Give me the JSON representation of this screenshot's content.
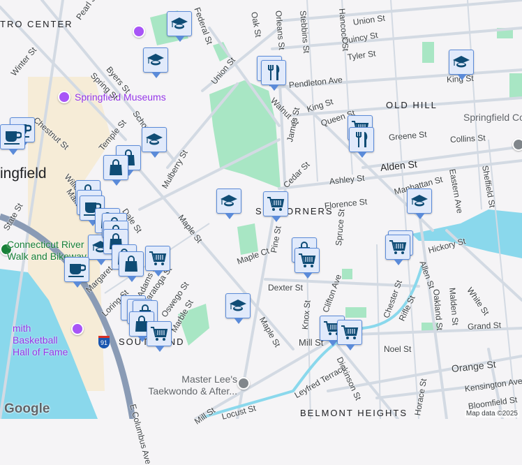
{
  "neighborhoods": [
    "TRO CENTER",
    "OLD HILL",
    "SIX CORNERS",
    "SOUTH END",
    "BELMONT HEIGHTS"
  ],
  "city": "ingfield",
  "pois": {
    "museums": "Springfield Museums",
    "riverwalk": "Connecticut River Walk and Bikeway",
    "hof": "mith Basketball Hall of Fame",
    "college": "Springfield Co",
    "taekwondo": "Master Lee's Taekwondo & After...",
    "highway_shield": "91"
  },
  "streets": [
    "Pearl St",
    "Winter St",
    "Byers St",
    "Spring St",
    "Chestnut St",
    "Temple St",
    "School St",
    "Union St",
    "Mulberry St",
    "Oak St",
    "Orleans St",
    "Stebbins St",
    "Hancock St",
    "Union St",
    "Quincy St",
    "Tyler St",
    "Pendleton Ave",
    "King St",
    "Walnut St",
    "Queen St",
    "James St",
    "Greene St",
    "Collins St",
    "King St",
    "Cedar St",
    "Alden St",
    "Ashley St",
    "Manhattan St",
    "Florence St",
    "Eastern Ave",
    "Sheffield St",
    "Maple St",
    "Main St",
    "State St",
    "Dale St",
    "Willow St",
    "Maple Ct",
    "Pine St",
    "Spruce St",
    "Hickory St",
    "Allen St",
    "Margaret St",
    "Loring St",
    "Saratoga St",
    "Oswego St",
    "Marble St",
    "Dexter St",
    "Clifton Ave",
    "Knox St",
    "Chester St",
    "Rifle St",
    "Oakland St",
    "Malden St",
    "White St",
    "Grand St",
    "Maple St",
    "Mill St",
    "Noel St",
    "Orange St",
    "Dickinson St",
    "Leyfred Terrace",
    "Kensington Ave",
    "Bloomfield St",
    "Horace St",
    "Locust St",
    "Mill St",
    "E Columbus Ave",
    "Federal St",
    "Adams St"
  ],
  "markers": {
    "school": "school-marker",
    "shopping": "shopping-bag-marker",
    "coffee": "cafe-marker",
    "restaurant": "restaurant-marker",
    "grocery": "grocery-cart-marker"
  },
  "colors": {
    "water": "#8ad8ec",
    "park": "#a8e6c4",
    "highway": "#8a9bb5",
    "road": "#d3dae3",
    "beige": "#f6ecd7",
    "marker_bg": "#e1eafb",
    "marker_icon": "#0f4c75"
  },
  "google_logo": "Google",
  "attribution": "Map data ©2025"
}
